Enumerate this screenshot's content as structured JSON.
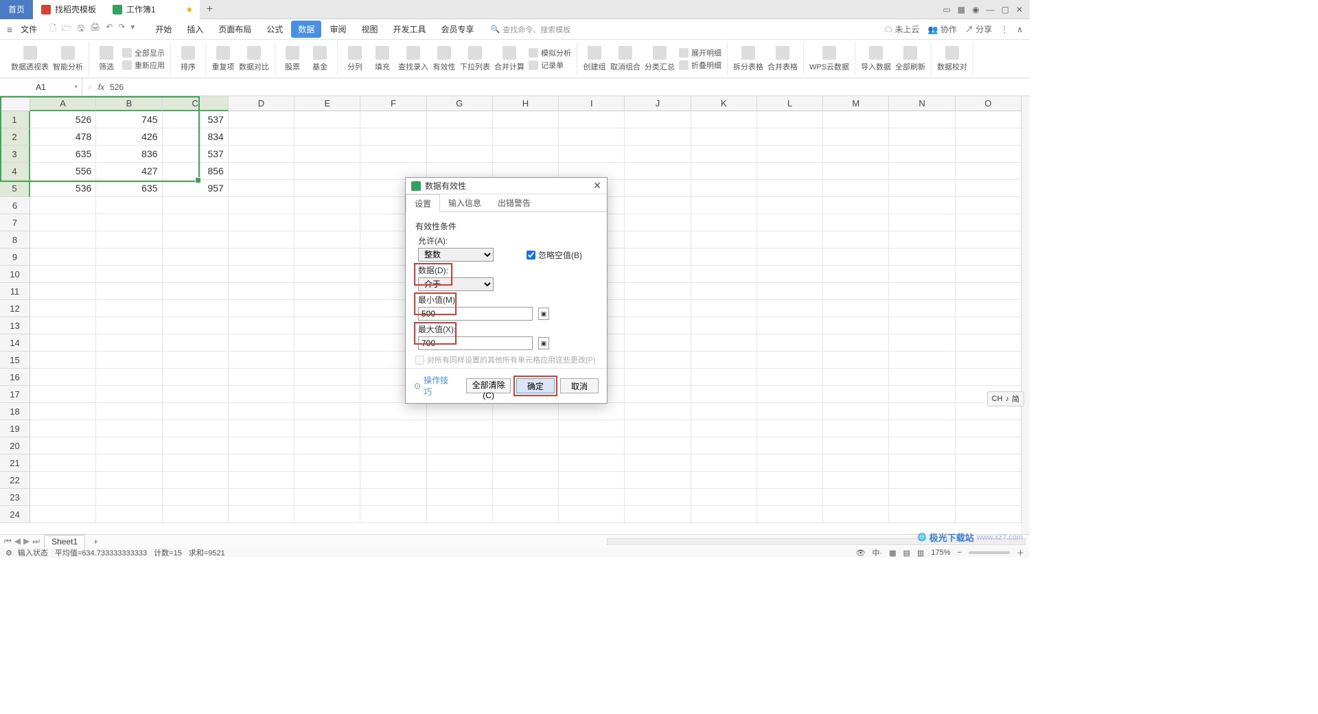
{
  "title_tabs": {
    "home": "首页",
    "template": "找稻壳模板",
    "doc": "工作簿1"
  },
  "menu": {
    "file": "文件",
    "tabs": [
      "开始",
      "插入",
      "页面布局",
      "公式",
      "数据",
      "审阅",
      "视图",
      "开发工具",
      "会员专享"
    ],
    "active_index": 4,
    "search_placeholder": "查找命令、搜索模板",
    "right": {
      "cloud": "未上云",
      "coop": "协作",
      "share": "分享"
    }
  },
  "ribbon": {
    "g1": [
      "数据透视表",
      "智能分析"
    ],
    "g2a": [
      "筛选"
    ],
    "g2b": [
      "全部显示",
      "重新应用"
    ],
    "g3": [
      "排序"
    ],
    "g4": [
      "重复项",
      "数据对比"
    ],
    "g5": [
      "股票",
      "基金"
    ],
    "g6": [
      "分列",
      "填充",
      "查找录入",
      "有效性",
      "下拉列表",
      "合并计算"
    ],
    "g6b": [
      "模拟分析",
      "记录单"
    ],
    "g7": [
      "创建组",
      "取消组合",
      "分类汇总"
    ],
    "g7b": [
      "展开明细",
      "折叠明细"
    ],
    "g8": [
      "拆分表格",
      "合并表格"
    ],
    "g9": [
      "WPS云数据"
    ],
    "g10": [
      "导入数据",
      "全部刷新"
    ],
    "g11": [
      "数据校对"
    ]
  },
  "formula_bar": {
    "name_box": "A1",
    "fx_value": "526"
  },
  "grid": {
    "columns": [
      "A",
      "B",
      "C",
      "D",
      "E",
      "F",
      "G",
      "H",
      "I",
      "J",
      "K",
      "L",
      "M",
      "N",
      "O"
    ],
    "rows_count": 24,
    "data": [
      [
        "526",
        "745",
        "537"
      ],
      [
        "478",
        "426",
        "834"
      ],
      [
        "635",
        "836",
        "537"
      ],
      [
        "556",
        "427",
        "856"
      ],
      [
        "536",
        "635",
        "957"
      ]
    ],
    "sel_cols": 3,
    "sel_rows": 5
  },
  "dialog": {
    "title": "数据有效性",
    "tabs": [
      "设置",
      "输入信息",
      "出错警告"
    ],
    "active_tab": 0,
    "section": "有效性条件",
    "allow_label": "允许(A):",
    "allow_value": "整数",
    "ignore_blank": "忽略空值(B)",
    "data_label": "数据(D):",
    "data_value": "介于",
    "min_label": "最小值(M):",
    "min_value": "500",
    "max_label": "最大值(X):",
    "max_value": "700",
    "apply_all": "对所有同样设置的其他所有单元格应用这些更改(P)",
    "tips": "操作技巧",
    "btn_clear": "全部清除(C)",
    "btn_ok": "确定",
    "btn_cancel": "取消"
  },
  "sheet": {
    "name": "Sheet1"
  },
  "status": {
    "mode": "输入状态",
    "avg_label": "平均值=",
    "avg": "634.733333333333",
    "cnt_label": "计数=",
    "cnt": "15",
    "sum_label": "求和=",
    "sum": "9521",
    "zoom": "175%"
  },
  "ime": {
    "lang": "CH",
    "mode": "简"
  },
  "watermark": {
    "brand": "极光下载站",
    "url": "www.xz7.com"
  }
}
